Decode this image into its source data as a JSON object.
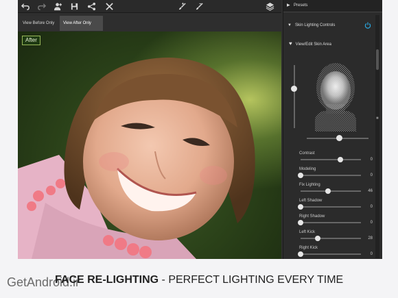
{
  "toolbar": {
    "icons": [
      "undo-icon",
      "redo-icon",
      "person-add-icon",
      "save-icon",
      "share-icon",
      "close-icon",
      "brush-icon",
      "brush-erase-icon",
      "layers-icon"
    ]
  },
  "view_tabs": [
    {
      "label": "View Before Only",
      "active": false
    },
    {
      "label": "View After Only",
      "active": true
    }
  ],
  "photo": {
    "state_label": "After"
  },
  "panel": {
    "presets_label": "Presets",
    "section_title": "Skin Lighting Controls",
    "view_edit_label": "View/Edit Skin Area",
    "adjustments": [
      {
        "label": "Contrast",
        "value": "0",
        "level": 0.66
      },
      {
        "label": "Modeling",
        "value": "0",
        "level": 0.0
      },
      {
        "label": "Fix Lighting",
        "value": "46",
        "level": 0.46
      },
      {
        "label": "Left Shadow",
        "value": "0",
        "level": 0.0
      },
      {
        "label": "Right Shadow",
        "value": "0",
        "level": 0.0
      },
      {
        "label": "Left Kick",
        "value": "28",
        "level": 0.28
      },
      {
        "label": "Right Kick",
        "value": "0",
        "level": 0.0
      }
    ],
    "light_vertical_level": 0.37,
    "light_horizontal_level": 0.52
  },
  "caption": {
    "watermark": "GetAndroid.ir",
    "title_bold": "FACE RE-LIGHTING",
    "title_rest": " - PERFECT LIGHTING EVERY TIME"
  },
  "colors": {
    "accent": "#2aa8e0",
    "badge_border": "#9ab85a"
  }
}
